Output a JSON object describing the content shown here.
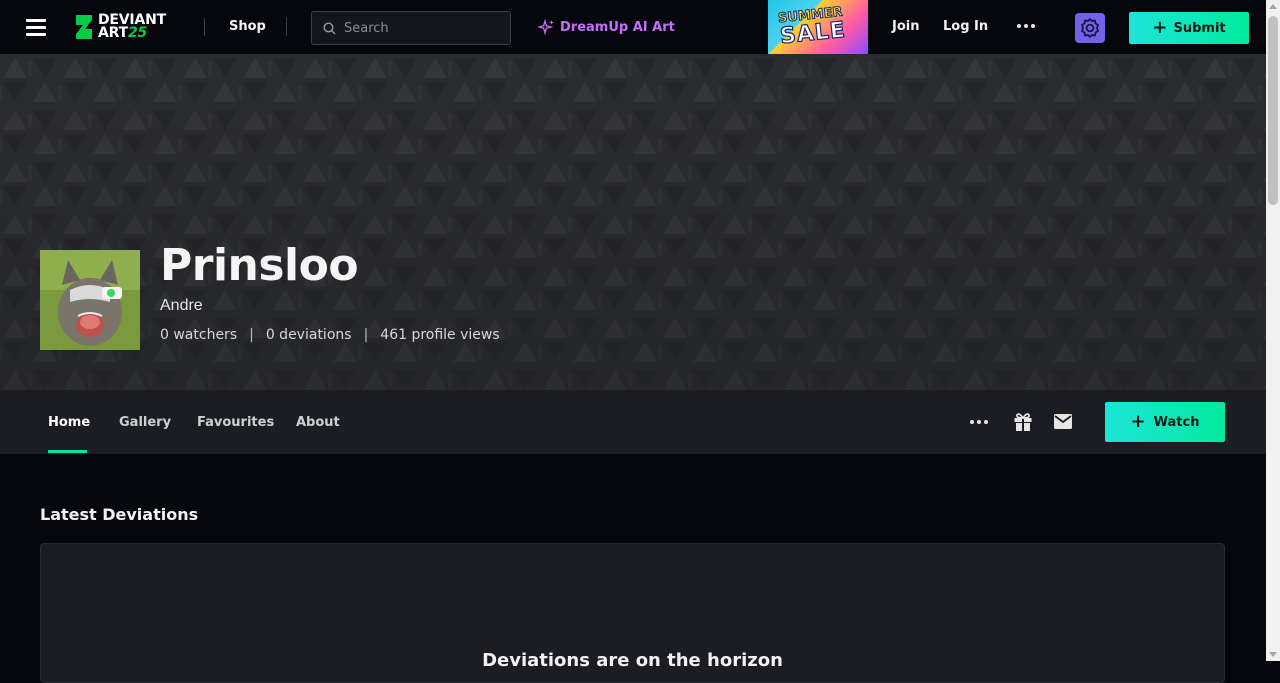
{
  "topbar": {
    "logo_line1": "DEVIANT",
    "logo_line2": "ART",
    "logo_year": "25",
    "shop_label": "Shop",
    "search_placeholder": "Search",
    "dreamup_label": "DreamUp AI Art",
    "sale_line1": "SUMMER",
    "sale_line2": "SALE",
    "join_label": "Join",
    "login_label": "Log In",
    "submit_label": "Submit"
  },
  "profile": {
    "username": "Prinsloo",
    "real_name": "Andre",
    "watchers": "0 watchers",
    "deviations": "0 deviations",
    "profile_views": "461 profile views",
    "stat_separator": "|"
  },
  "profile_nav": {
    "tabs": [
      {
        "label": "Home",
        "active": true
      },
      {
        "label": "Gallery",
        "active": false
      },
      {
        "label": "Favourites",
        "active": false
      },
      {
        "label": "About",
        "active": false
      }
    ],
    "watch_label": "Watch"
  },
  "content": {
    "section_title": "Latest Deviations",
    "empty_title": "Deviations are on the horizon"
  },
  "colors": {
    "accent_green": "#00e59b",
    "dreamup_purple": "#c86bff",
    "core_badge": "#6f63e8"
  },
  "icons": {
    "menu": "hamburger-icon",
    "search": "search-icon",
    "sparkle": "sparkle-icon",
    "more": "more-dots-icon",
    "core": "core-badge-icon",
    "gift": "gift-icon",
    "mail": "mail-icon"
  }
}
